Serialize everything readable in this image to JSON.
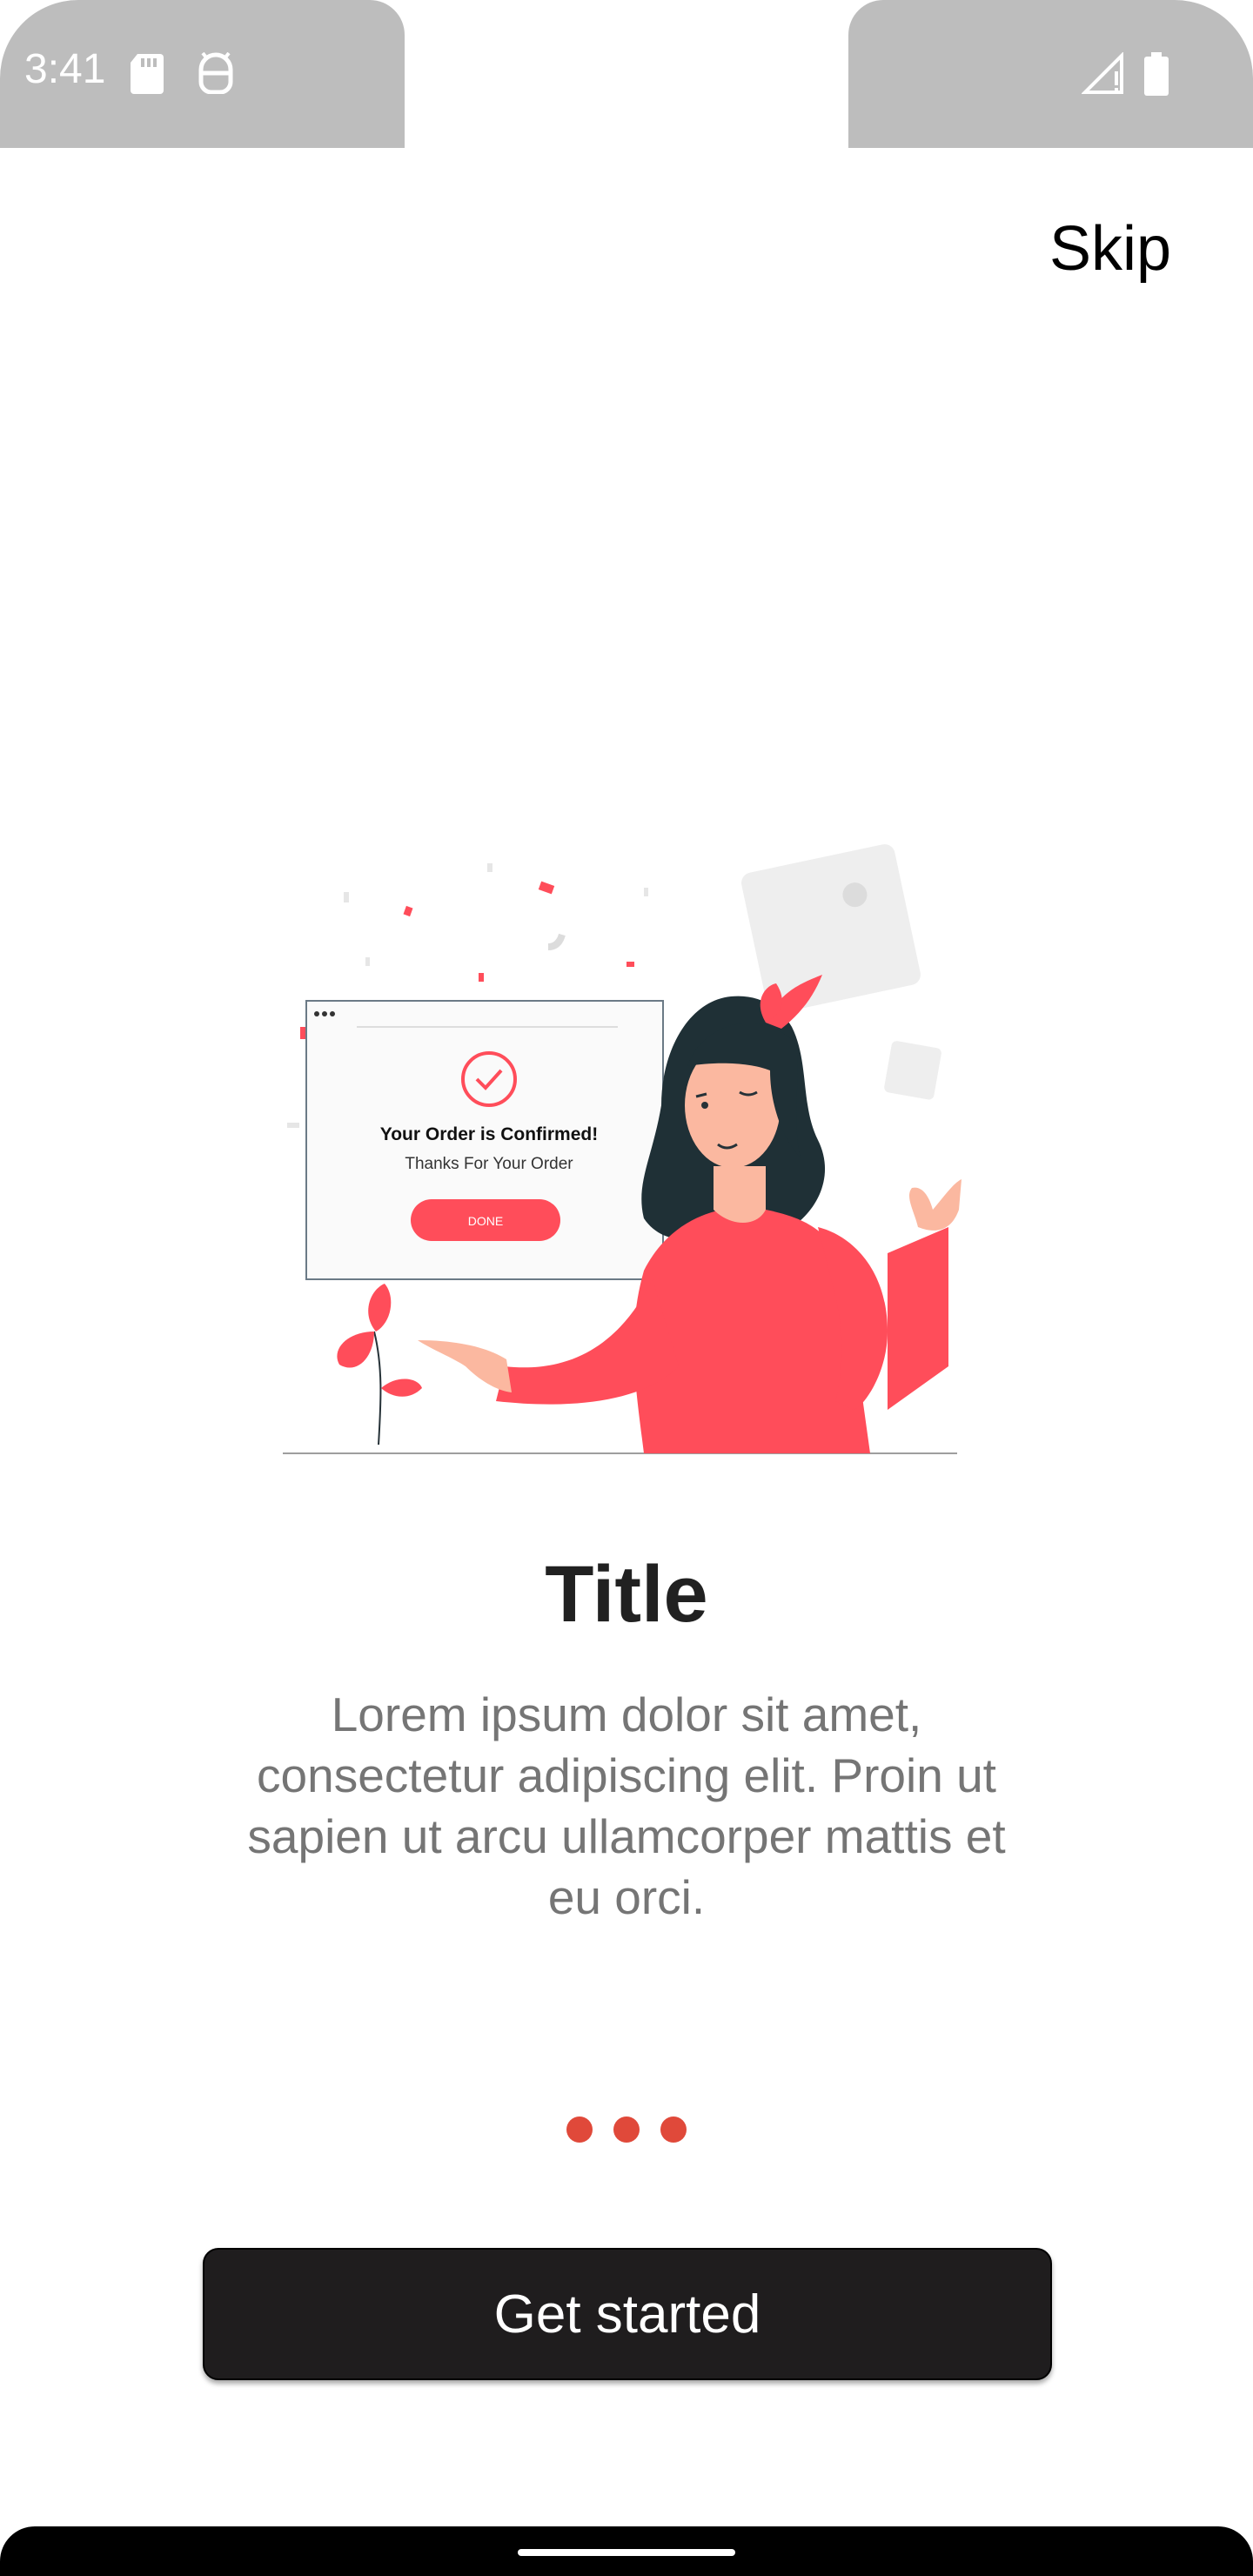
{
  "status_bar": {
    "time": "3:41",
    "icons": [
      "sd-card-icon",
      "android-face-icon",
      "signal-icon",
      "battery-icon"
    ],
    "background": "#bdbdbd"
  },
  "skip_label": "Skip",
  "illustration": {
    "card_title": "Your Order is Confirmed!",
    "card_subtitle": "Thanks For Your Order",
    "card_button": "DONE",
    "accent": "#ff4d5a"
  },
  "title": "Title",
  "description": "Lorem ipsum dolor sit amet, consectetur adipiscing elit. Proin ut sapien ut arcu ullamcorper mattis et eu orci.",
  "pager": {
    "count": 3,
    "color": "#e0493a"
  },
  "cta_label": "Get started"
}
